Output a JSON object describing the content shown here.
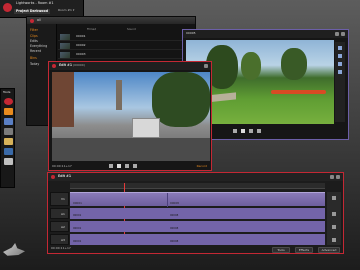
{
  "app": {
    "title": "Lightworks - Room #1",
    "project_label": "Project Darkwood",
    "room_menu": "Room #1 ▾"
  },
  "browser": {
    "title": "all",
    "tab_1": "Filmed",
    "tab_2": "Sound",
    "groups": [
      "Filter",
      "Clips",
      "Edits",
      "Everything",
      "Recent",
      "Bins",
      "Today"
    ],
    "rows": [
      "00001",
      "00002",
      "00003",
      "00004",
      "00005",
      "00006"
    ]
  },
  "source_viewer": {
    "title": "00005",
    "timecode": "00:00:00+00"
  },
  "record_viewer": {
    "title": "Edit #1",
    "subtitle": "(00000)",
    "timecode": "00:00:11+17",
    "status": "Record"
  },
  "tools": {
    "title": "Tools"
  },
  "timeline": {
    "title": "Edit #1",
    "timecode": "00:00:11+17",
    "tracks": [
      "V1",
      "A1",
      "A2",
      "A3"
    ],
    "clip_labels": [
      "00001",
      "00008"
    ],
    "buttons": [
      "Tools",
      "Effects",
      "Advanced"
    ]
  },
  "colors": {
    "accent_red": "#c42834",
    "accent_orange": "#e98b1e",
    "accent_purple": "#6c5fa8",
    "clip_purple": "#7a6cb0"
  }
}
